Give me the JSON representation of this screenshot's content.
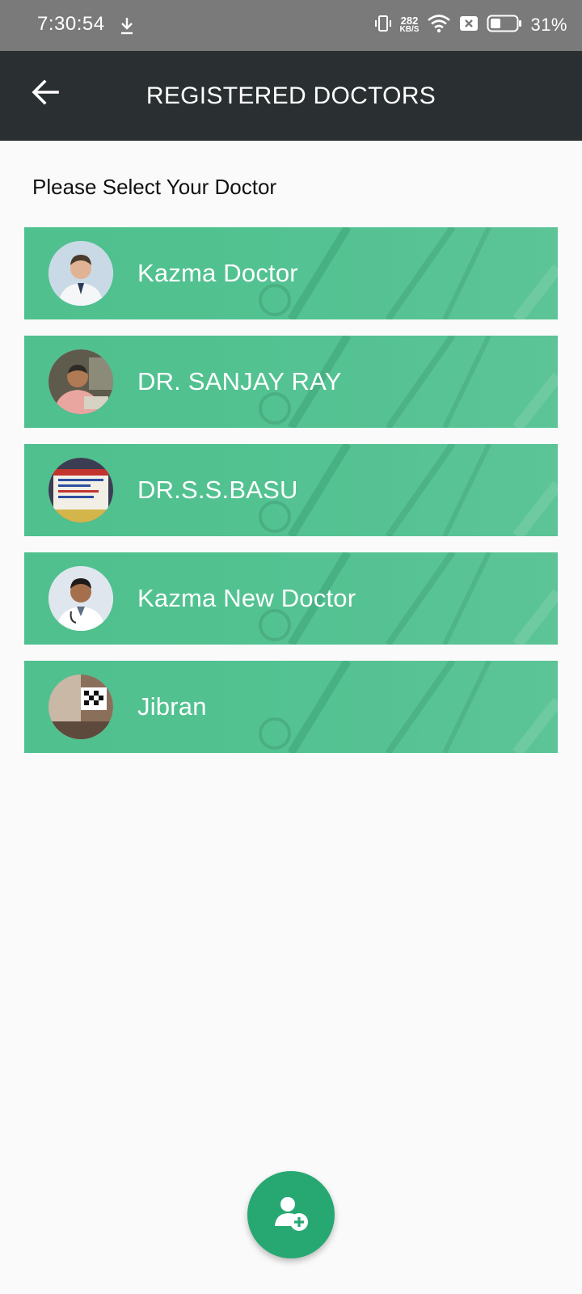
{
  "status_bar": {
    "time": "7:30:54",
    "net_speed_value": "282",
    "net_speed_unit": "KB/S",
    "battery_percent": "31%",
    "icons": [
      "download-icon",
      "vibrate-icon",
      "wifi-icon",
      "sim-off-icon",
      "battery-icon"
    ]
  },
  "app_bar": {
    "title": "REGISTERED DOCTORS",
    "back_icon": "arrow-left-icon"
  },
  "content": {
    "prompt": "Please Select Your Doctor",
    "doctors": [
      {
        "name": "Kazma Doctor"
      },
      {
        "name": "DR. SANJAY RAY"
      },
      {
        "name": "DR.S.S.BASU"
      },
      {
        "name": "Kazma New Doctor"
      },
      {
        "name": "Jibran"
      }
    ]
  },
  "fab": {
    "icon": "add-person-icon"
  },
  "colors": {
    "status_bar": "#7a7a7a",
    "app_bar": "#2a2f32",
    "card": "#54c292",
    "fab": "#27a873",
    "background": "#fafafa"
  }
}
